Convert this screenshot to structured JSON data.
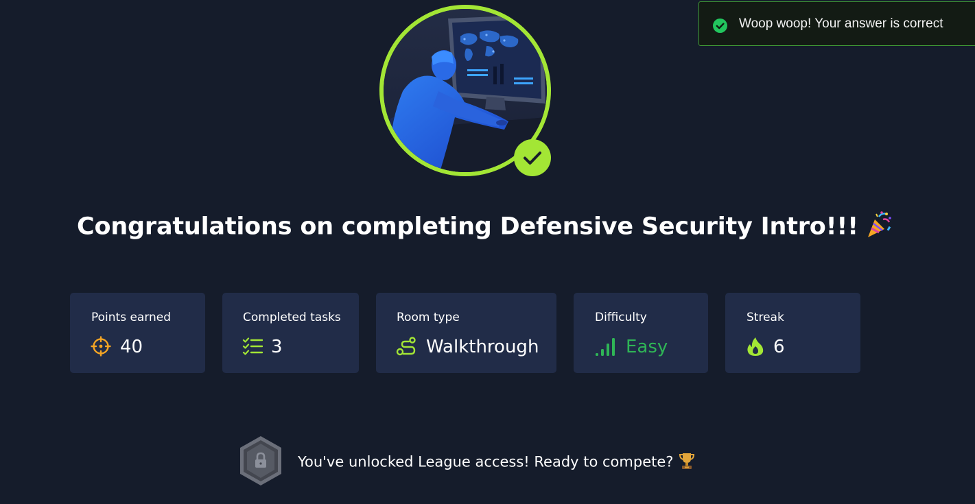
{
  "toast": {
    "message": "Woop woop! Your answer is correct",
    "icon": "check-circle-icon",
    "accent": "#3f9a35"
  },
  "badge": {
    "accent": "#a3e635",
    "icon": "check-icon"
  },
  "title": "Congratulations on completing Defensive Security Intro!!!",
  "title_emoji": "party-popper-icon",
  "stats": {
    "points": {
      "label": "Points earned",
      "value": "40",
      "icon": "crosshair-icon"
    },
    "tasks": {
      "label": "Completed tasks",
      "value": "3",
      "icon": "checklist-icon"
    },
    "room": {
      "label": "Room type",
      "value": "Walkthrough",
      "icon": "route-icon"
    },
    "difficulty": {
      "label": "Difficulty",
      "value": "Easy",
      "icon": "signal-bars-icon",
      "color": "#2fb556"
    },
    "streak": {
      "label": "Streak",
      "value": "6",
      "icon": "flame-icon"
    }
  },
  "league": {
    "message": "You've unlocked League access! Ready to compete?",
    "icon": "locked-league-badge-icon",
    "emoji": "trophy-icon"
  }
}
